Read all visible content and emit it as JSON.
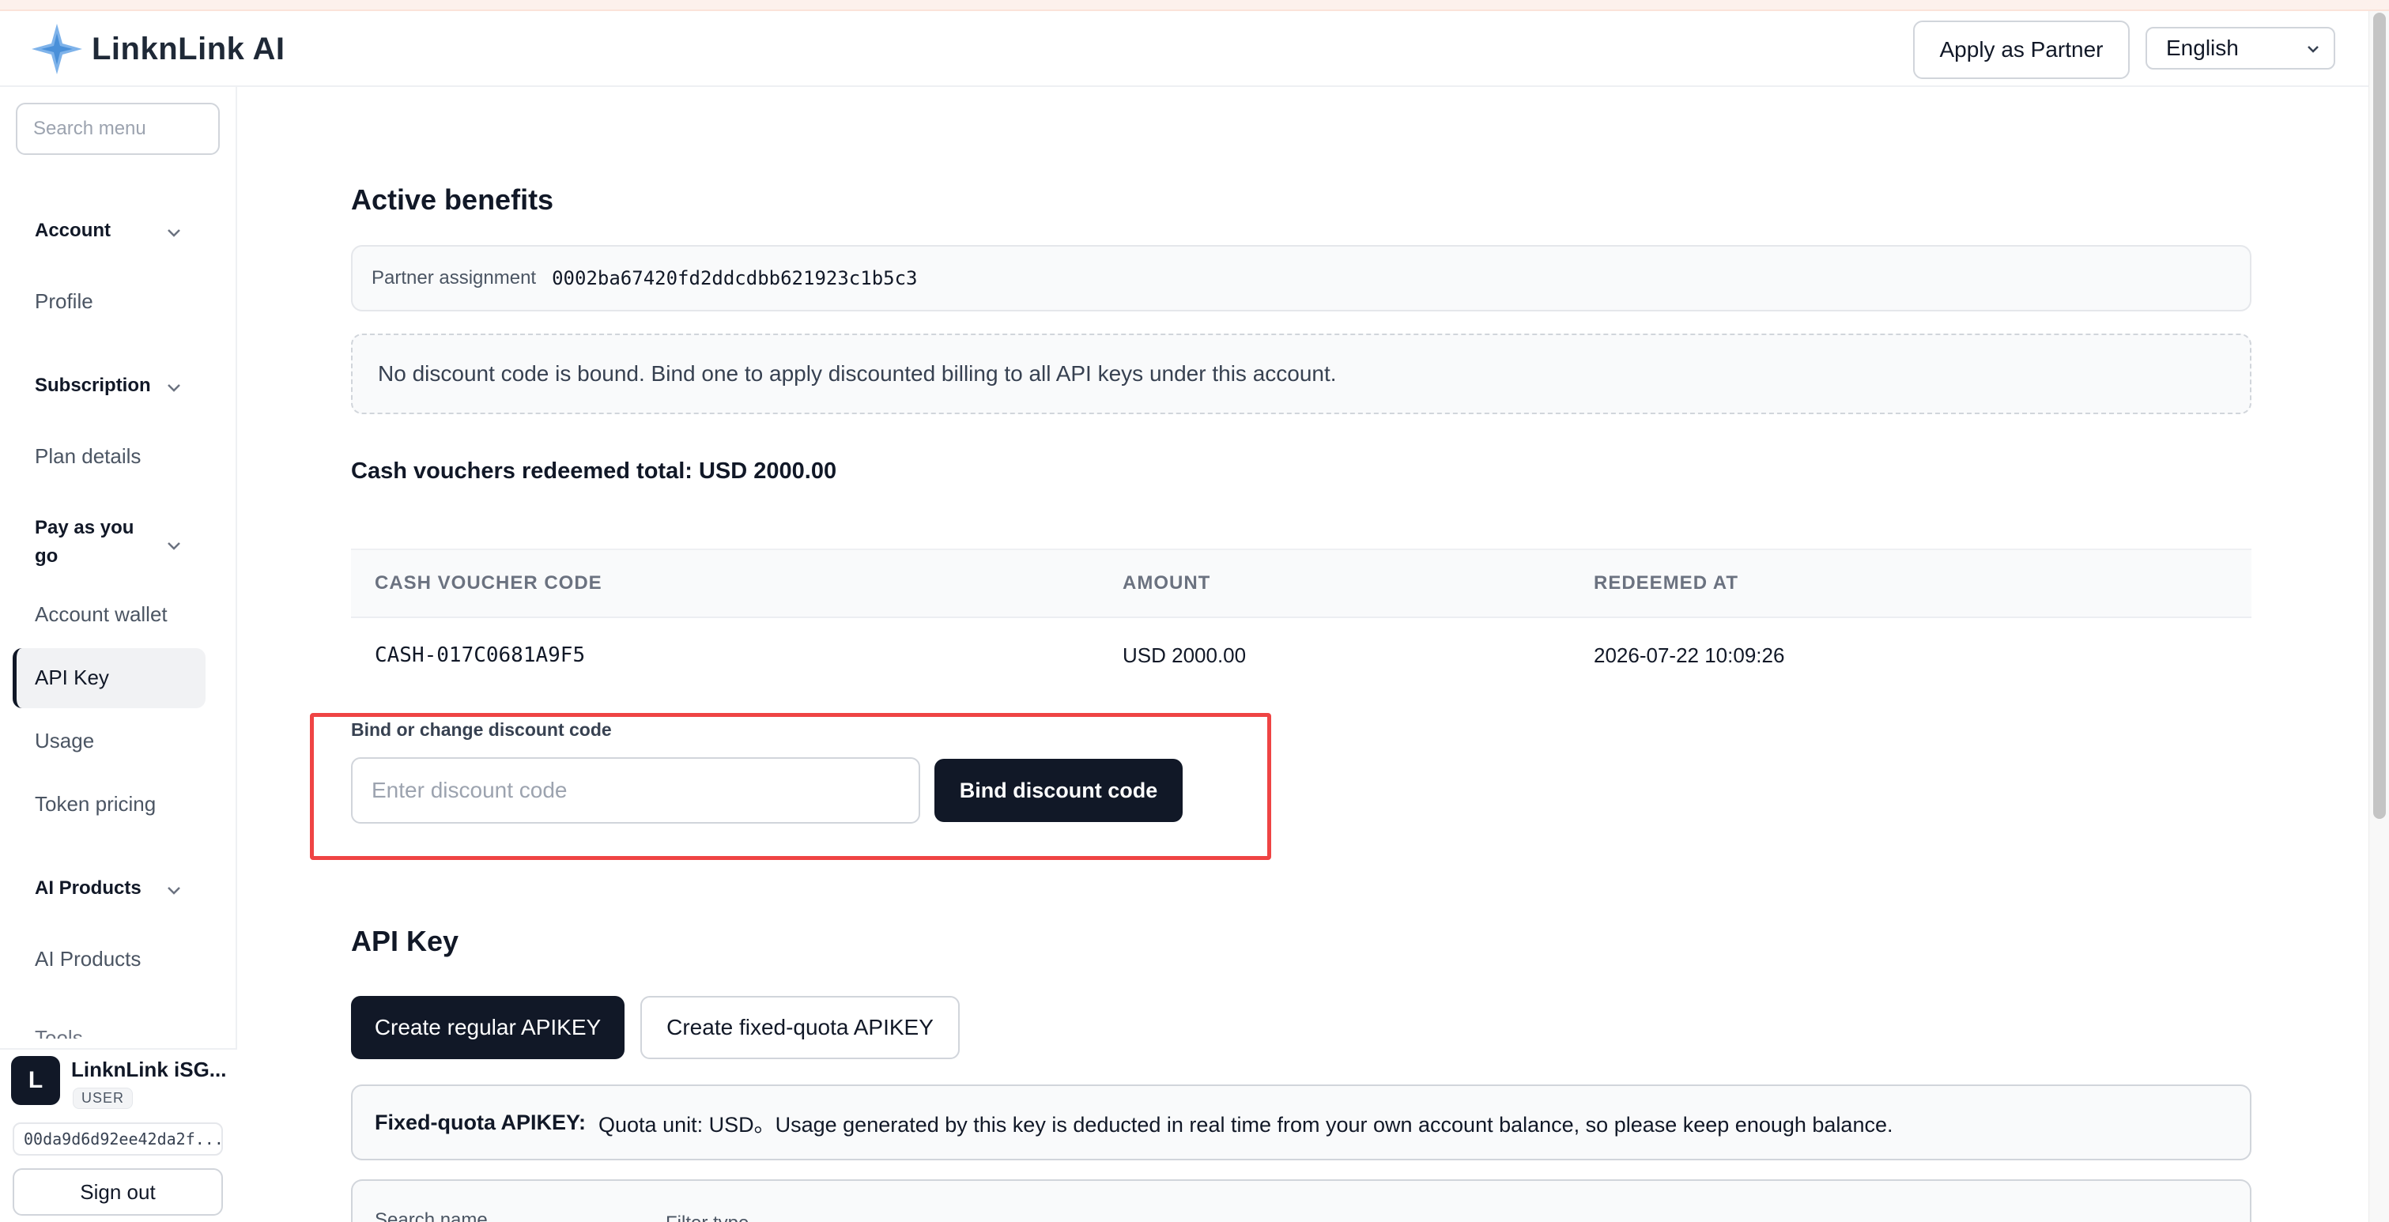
{
  "header": {
    "brand": "LinknLink AI",
    "apply_partner_label": "Apply as Partner",
    "language": "English"
  },
  "sidebar": {
    "search_placeholder": "Search menu",
    "sections": {
      "account": {
        "title": "Account",
        "items": [
          "Profile"
        ]
      },
      "subscription": {
        "title": "Subscription",
        "items": [
          "Plan details"
        ]
      },
      "payg": {
        "title_line1": "Pay as you",
        "title_line2": "go",
        "items": [
          "Account wallet",
          "API Key",
          "Usage",
          "Token pricing"
        ]
      },
      "ai_products": {
        "title": "AI Products",
        "items": [
          "AI Products"
        ]
      }
    },
    "cut_item": "Tools",
    "user": {
      "initial": "L",
      "name": "LinknLink iSG...",
      "role": "USER",
      "id": "00da9d6d92ee42da2f...",
      "sign_out_label": "Sign out"
    }
  },
  "main": {
    "active_benefits_title": "Active benefits",
    "partner_assignment_label": "Partner assignment",
    "partner_assignment_value": "0002ba67420fd2ddcdbb621923c1b5c3",
    "no_discount_notice": "No discount code is bound. Bind one to apply discounted billing to all API keys under this account.",
    "cash_total": "Cash vouchers redeemed total: USD 2000.00",
    "voucher_table": {
      "headers": [
        "CASH VOUCHER CODE",
        "AMOUNT",
        "REDEEMED AT"
      ],
      "rows": [
        [
          "CASH-017C0681A9F5",
          "USD 2000.00",
          "2026-07-22 10:09:26"
        ]
      ]
    },
    "bind_label": "Bind or change discount code",
    "bind_placeholder": "Enter discount code",
    "bind_button": "Bind discount code",
    "api_key_title": "API Key",
    "create_regular_label": "Create regular APIKEY",
    "create_fixed_label": "Create fixed-quota APIKEY",
    "fixed_quota_title": "Fixed-quota APIKEY:",
    "fixed_quota_text": "Quota unit: USD。Usage generated by this key is deducted in real time from your own account balance, so please keep enough balance.",
    "filter_name_label": "Search name",
    "filter_type_label": "Filter type"
  },
  "colors": {
    "primary_dark": "#111827",
    "highlight_red": "#ef4444",
    "brand_blue": "#60a5fa"
  }
}
